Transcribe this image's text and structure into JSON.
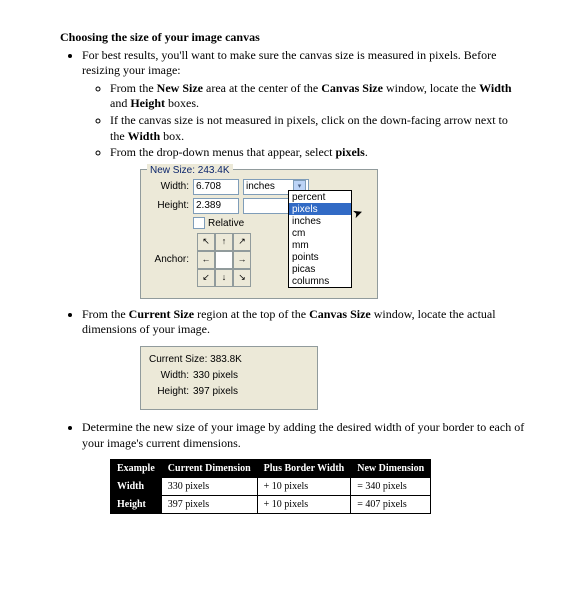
{
  "title": "Choosing the size of your image canvas",
  "bullet1": "For best results, you'll want to make sure the canvas size is measured in pixels.  Before resizing your image:",
  "sub1a_pre": "From the ",
  "sub1a_b1": "New Size",
  "sub1a_mid": " area at the center of the ",
  "sub1a_b2": "Canvas Size",
  "sub1a_post": " window, locate the ",
  "sub1a_b3": "Width",
  "sub1a_and": " and ",
  "sub1a_b4": "Height",
  "sub1a_end": " boxes.",
  "sub1b_pre": "If the canvas size is not measured in pixels, click on the down-facing arrow next to the ",
  "sub1b_b": "Width",
  "sub1b_end": " box.",
  "sub1c_pre": "From the drop-down menus that appear, select ",
  "sub1c_b": "pixels",
  "sub1c_end": ".",
  "panel1": {
    "legend": "New Size: 243.4K",
    "width_label": "Width:",
    "width_val": "6.708",
    "height_label": "Height:",
    "height_val": "2.389",
    "unit": "inches",
    "relative": "Relative",
    "anchor_label": "Anchor:",
    "dd": {
      "o0": "percent",
      "o1": "pixels",
      "o2": "inches",
      "o3": "cm",
      "o4": "mm",
      "o5": "points",
      "o6": "picas",
      "o7": "columns"
    }
  },
  "bullet2_pre": "From the ",
  "bullet2_b1": "Current Size",
  "bullet2_mid": " region at the top of the ",
  "bullet2_b2": "Canvas Size",
  "bullet2_end": " window, locate the actual dimensions of your image.",
  "panel2": {
    "legend": "Current Size: 383.8K",
    "w_label": "Width:",
    "w_val": "330 pixels",
    "h_label": "Height:",
    "h_val": "397 pixels"
  },
  "bullet3": "Determine the new size of your image by adding the desired width of your border to each of your image's current dimensions.",
  "table": {
    "h0": "Example",
    "h1": "Current Dimension",
    "h2": "Plus Border Width",
    "h3": "New Dimension",
    "r1": {
      "c0": "Width",
      "c1": "330 pixels",
      "c2": "+ 10 pixels",
      "c3": "= 340 pixels"
    },
    "r2": {
      "c0": "Height",
      "c1": "397 pixels",
      "c2": "+ 10 pixels",
      "c3": "= 407 pixels"
    }
  }
}
